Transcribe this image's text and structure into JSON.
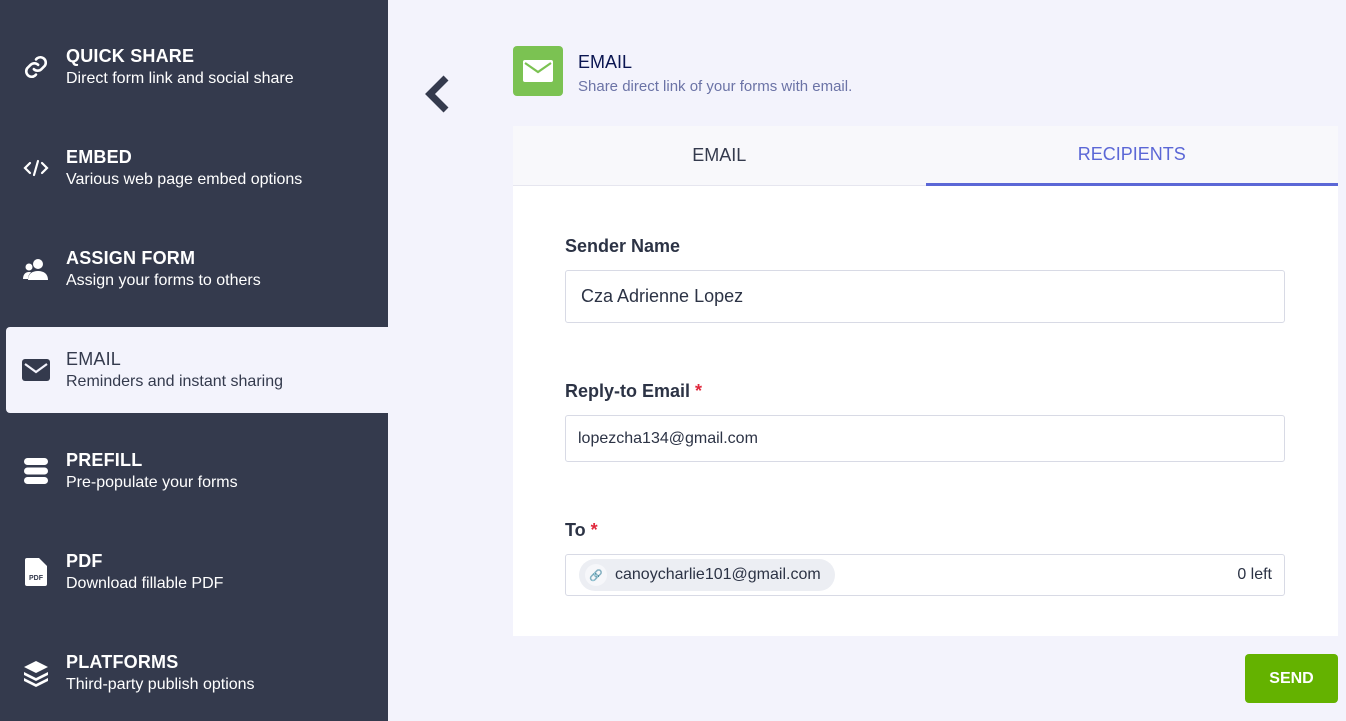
{
  "sidebar": {
    "items": [
      {
        "title": "QUICK SHARE",
        "sub": "Direct form link and social share",
        "icon": "link-icon"
      },
      {
        "title": "EMBED",
        "sub": "Various web page embed options",
        "icon": "code-icon"
      },
      {
        "title": "ASSIGN FORM",
        "sub": "Assign your forms to others",
        "icon": "users-icon"
      },
      {
        "title": "EMAIL",
        "sub": "Reminders and instant sharing",
        "icon": "envelope-icon"
      },
      {
        "title": "PREFILL",
        "sub": "Pre-populate your forms",
        "icon": "stack-icon"
      },
      {
        "title": "PDF",
        "sub": "Download fillable PDF",
        "icon": "pdf-icon"
      },
      {
        "title": "PLATFORMS",
        "sub": "Third-party publish options",
        "icon": "layers-icon"
      }
    ]
  },
  "header": {
    "title": "EMAIL",
    "subtitle": "Share direct link of your forms with email."
  },
  "tabs": [
    "EMAIL",
    "RECIPIENTS"
  ],
  "form": {
    "sender_label": "Sender Name",
    "sender_value": "Cza Adrienne Lopez",
    "reply_label": "Reply-to Email",
    "reply_value": "lopezcha134@gmail.com",
    "to_label": "To",
    "to_chip": "canoycharlie101@gmail.com",
    "left": "0 left",
    "required": "*"
  },
  "send": "SEND",
  "colors": {
    "sidebar": "#343a4d",
    "accent": "#5b67d6",
    "send": "#64b200",
    "email_icon": "#7bc252"
  }
}
